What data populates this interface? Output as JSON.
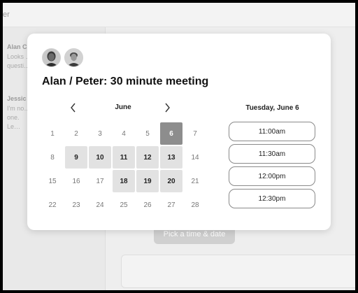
{
  "background": {
    "header_title": "er",
    "conversations": [
      {
        "name": "Alan C",
        "preview": "Looks … questi…"
      },
      {
        "name": "Jessic",
        "preview": "I'm no… one. Le…"
      }
    ],
    "pick_button_label": "Pick a time & date"
  },
  "modal": {
    "title": "Alan / Peter: 30 minute meeting",
    "participants": [
      "alan-avatar",
      "peter-avatar"
    ],
    "calendar": {
      "month": "June",
      "prev_icon": "chevron-left-icon",
      "next_icon": "chevron-right-icon",
      "weeks": [
        [
          {
            "d": "1",
            "s": "none"
          },
          {
            "d": "2",
            "s": "none"
          },
          {
            "d": "3",
            "s": "none"
          },
          {
            "d": "4",
            "s": "none"
          },
          {
            "d": "5",
            "s": "none"
          },
          {
            "d": "6",
            "s": "selected"
          },
          {
            "d": "7",
            "s": "none"
          }
        ],
        [
          {
            "d": "8",
            "s": "none"
          },
          {
            "d": "9",
            "s": "avail"
          },
          {
            "d": "10",
            "s": "avail"
          },
          {
            "d": "11",
            "s": "avail"
          },
          {
            "d": "12",
            "s": "avail"
          },
          {
            "d": "13",
            "s": "avail"
          },
          {
            "d": "14",
            "s": "none"
          }
        ],
        [
          {
            "d": "15",
            "s": "none"
          },
          {
            "d": "16",
            "s": "none"
          },
          {
            "d": "17",
            "s": "none"
          },
          {
            "d": "18",
            "s": "avail"
          },
          {
            "d": "19",
            "s": "avail"
          },
          {
            "d": "20",
            "s": "avail"
          },
          {
            "d": "21",
            "s": "none"
          }
        ],
        [
          {
            "d": "22",
            "s": "none"
          },
          {
            "d": "23",
            "s": "none"
          },
          {
            "d": "24",
            "s": "none"
          },
          {
            "d": "25",
            "s": "none"
          },
          {
            "d": "26",
            "s": "none"
          },
          {
            "d": "27",
            "s": "none"
          },
          {
            "d": "28",
            "s": "none"
          }
        ]
      ]
    },
    "selected_date_heading": "Tuesday, June 6",
    "time_slots": [
      "11:00am",
      "11:30am",
      "12:00pm",
      "12:30pm"
    ]
  },
  "colors": {
    "selected_day": "#8d8d8d",
    "available_day": "#e2e2e2"
  }
}
